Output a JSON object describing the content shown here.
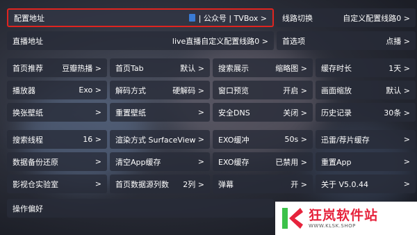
{
  "rows": [
    [
      {
        "label": "配置地址",
        "value": "| 公众号 | TVBox >",
        "icon": "document-icon"
      },
      {
        "label": "线路切换",
        "value": "自定义配置线路0 >"
      }
    ],
    [
      {
        "label": "直播地址",
        "value": "live直播自定义配置线路0 >"
      },
      {
        "label": "首选项",
        "value": "点播 >"
      }
    ],
    [
      {
        "label": "首页推荐",
        "value": "豆瓣热播 >"
      },
      {
        "label": "首页Tab",
        "value": "默认 >"
      },
      {
        "label": "搜索展示",
        "value": "缩略图 >"
      },
      {
        "label": "缓存时长",
        "value": "1天 >"
      }
    ],
    [
      {
        "label": "播放器",
        "value": "Exo >"
      },
      {
        "label": "解码方式",
        "value": "硬解码 >"
      },
      {
        "label": "窗口预览",
        "value": "开启 >"
      },
      {
        "label": "画面缩放",
        "value": "默认 >"
      }
    ],
    [
      {
        "label": "换张壁纸",
        "value": ">"
      },
      {
        "label": "重置壁纸",
        "value": ">"
      },
      {
        "label": "安全DNS",
        "value": "关闭 >"
      },
      {
        "label": "历史记录",
        "value": "30条 >"
      }
    ],
    [
      {
        "label": "搜索线程",
        "value": "16 >"
      },
      {
        "label": "渲染方式 SurfaceView",
        "value": ">"
      },
      {
        "label": "EXO缓冲",
        "value": "50s >"
      },
      {
        "label": "迅雷/荐片缓存",
        "value": ">"
      }
    ],
    [
      {
        "label": "数据备份还原",
        "value": ">"
      },
      {
        "label": "清空App缓存",
        "value": ">"
      },
      {
        "label": "EXO缓存",
        "value": "已禁用 >"
      },
      {
        "label": "重置App",
        "value": ">"
      }
    ],
    [
      {
        "label": "影视仓实验室",
        "value": ">"
      },
      {
        "label": "首页数据源列数",
        "value": "2列 >"
      },
      {
        "label": "弹幕",
        "value": "开 >"
      },
      {
        "label": "关于  V5.0.44",
        "value": ">"
      }
    ],
    [
      {
        "label": "操作偏好",
        "value": ""
      }
    ]
  ],
  "watermark": {
    "title": "狂岚软件站",
    "url": "WWW.KLSK.SHOP"
  },
  "colors": {
    "focus_border": "#e0241f",
    "watermark_red": "#e6233c",
    "logo_green": "#3cc24a",
    "logo_pink": "#e6233c"
  }
}
